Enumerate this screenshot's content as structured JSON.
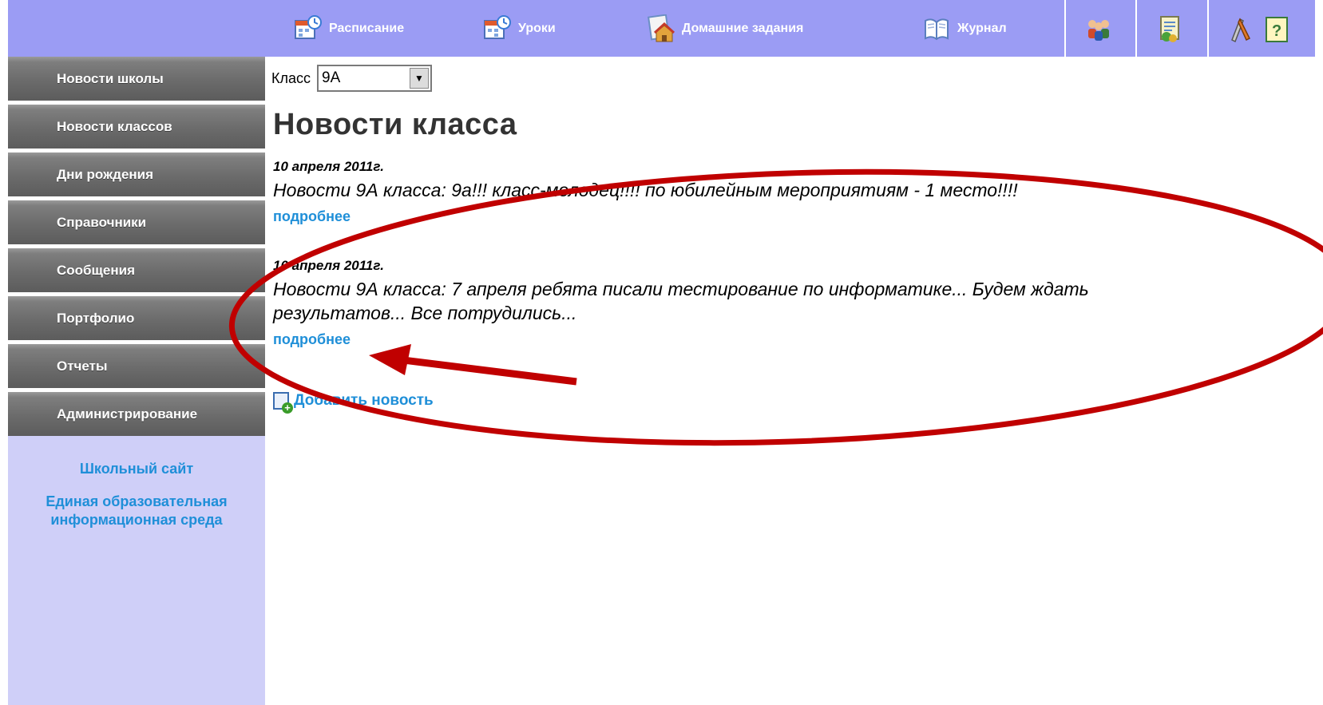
{
  "topnav": {
    "items": [
      {
        "label": "Расписание",
        "icon": "calendar-icon"
      },
      {
        "label": "Уроки",
        "icon": "lessons-calendar-icon"
      },
      {
        "label": "Домашние задания",
        "icon": "homework-icon"
      },
      {
        "label": "Журнал",
        "icon": "journal-book-icon"
      }
    ],
    "extra_icons": [
      "students-group-icon",
      "reports-icon",
      "tools-icon",
      "help-icon"
    ],
    "colors": {
      "bar": "#9b9cf4"
    }
  },
  "sidebar": {
    "items": [
      {
        "label": "Новости школы"
      },
      {
        "label": "Новости классов"
      },
      {
        "label": "Дни рождения"
      },
      {
        "label": "Справочники"
      },
      {
        "label": "Сообщения"
      },
      {
        "label": "Портфолио"
      },
      {
        "label": "Отчеты"
      },
      {
        "label": "Администрирование"
      }
    ],
    "links": [
      {
        "label": "Школьный сайт"
      },
      {
        "label": "Единая образовательная\nинформационная среда"
      }
    ]
  },
  "main": {
    "class_label": "Класс",
    "class_value": "9А",
    "title": "Новости класса",
    "news": [
      {
        "date": "10 апреля 2011г.",
        "text": "Новости 9А класса: 9а!!! класс-молодец!!!! по юбилейным мероприятиям - 1 место!!!!",
        "more": "подробнее"
      },
      {
        "date": "10 апреля 2011г.",
        "text": "Новости 9А класса: 7 апреля ребята писали тестирование по информатике... Будем ждать\nрезультатов... Все потрудились...",
        "more": "подробнее"
      }
    ],
    "add_news": "Добавить новость"
  },
  "annotation": {
    "color": "#c00000"
  }
}
